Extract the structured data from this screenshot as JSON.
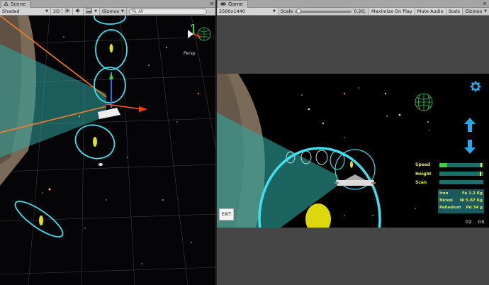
{
  "scene": {
    "tab_title": "Scene",
    "shading_mode": "Shaded",
    "mode_2d": "2D",
    "gizmos_label": "Gizmos",
    "search_placeholder": "All",
    "persp_label": "Persp"
  },
  "game": {
    "tab_title": "Game",
    "resolution": "2560x1440",
    "scale_label": "Scale",
    "scale_value": "0.26;",
    "maximize_on_play": "Maximize On Play",
    "mute_audio": "Mute Audio",
    "stats": "Stats",
    "gizmos_label": "Gizmos",
    "exit_label": "EXIT",
    "hud": {
      "speed_label": "Speed",
      "height_label": "Height",
      "scan_label": "Scan",
      "speed_fill": 0.18,
      "height_marker": 0.95,
      "speed_marker": 0.97
    },
    "resources": [
      {
        "name": "Iron",
        "value": "Fe 1.2 Kg"
      },
      {
        "name": "Nickel",
        "value": "Ni 5.87 Kg"
      },
      {
        "name": "Palladium",
        "value": "Pd 34 g"
      }
    ],
    "timer_min": "02",
    "timer_sec": "00"
  },
  "colors": {
    "tab_bg": "#c2c2c2",
    "toolbar_bg": "#c8c8c8",
    "ring_cyan": "#3fe0f0",
    "hud_yellow": "#e8f04a",
    "bar_teal": "#1f6e6e",
    "bar_green": "#3ecf3e",
    "arrow_blue": "#29a8e8",
    "orange_line": "#ff7a20"
  }
}
